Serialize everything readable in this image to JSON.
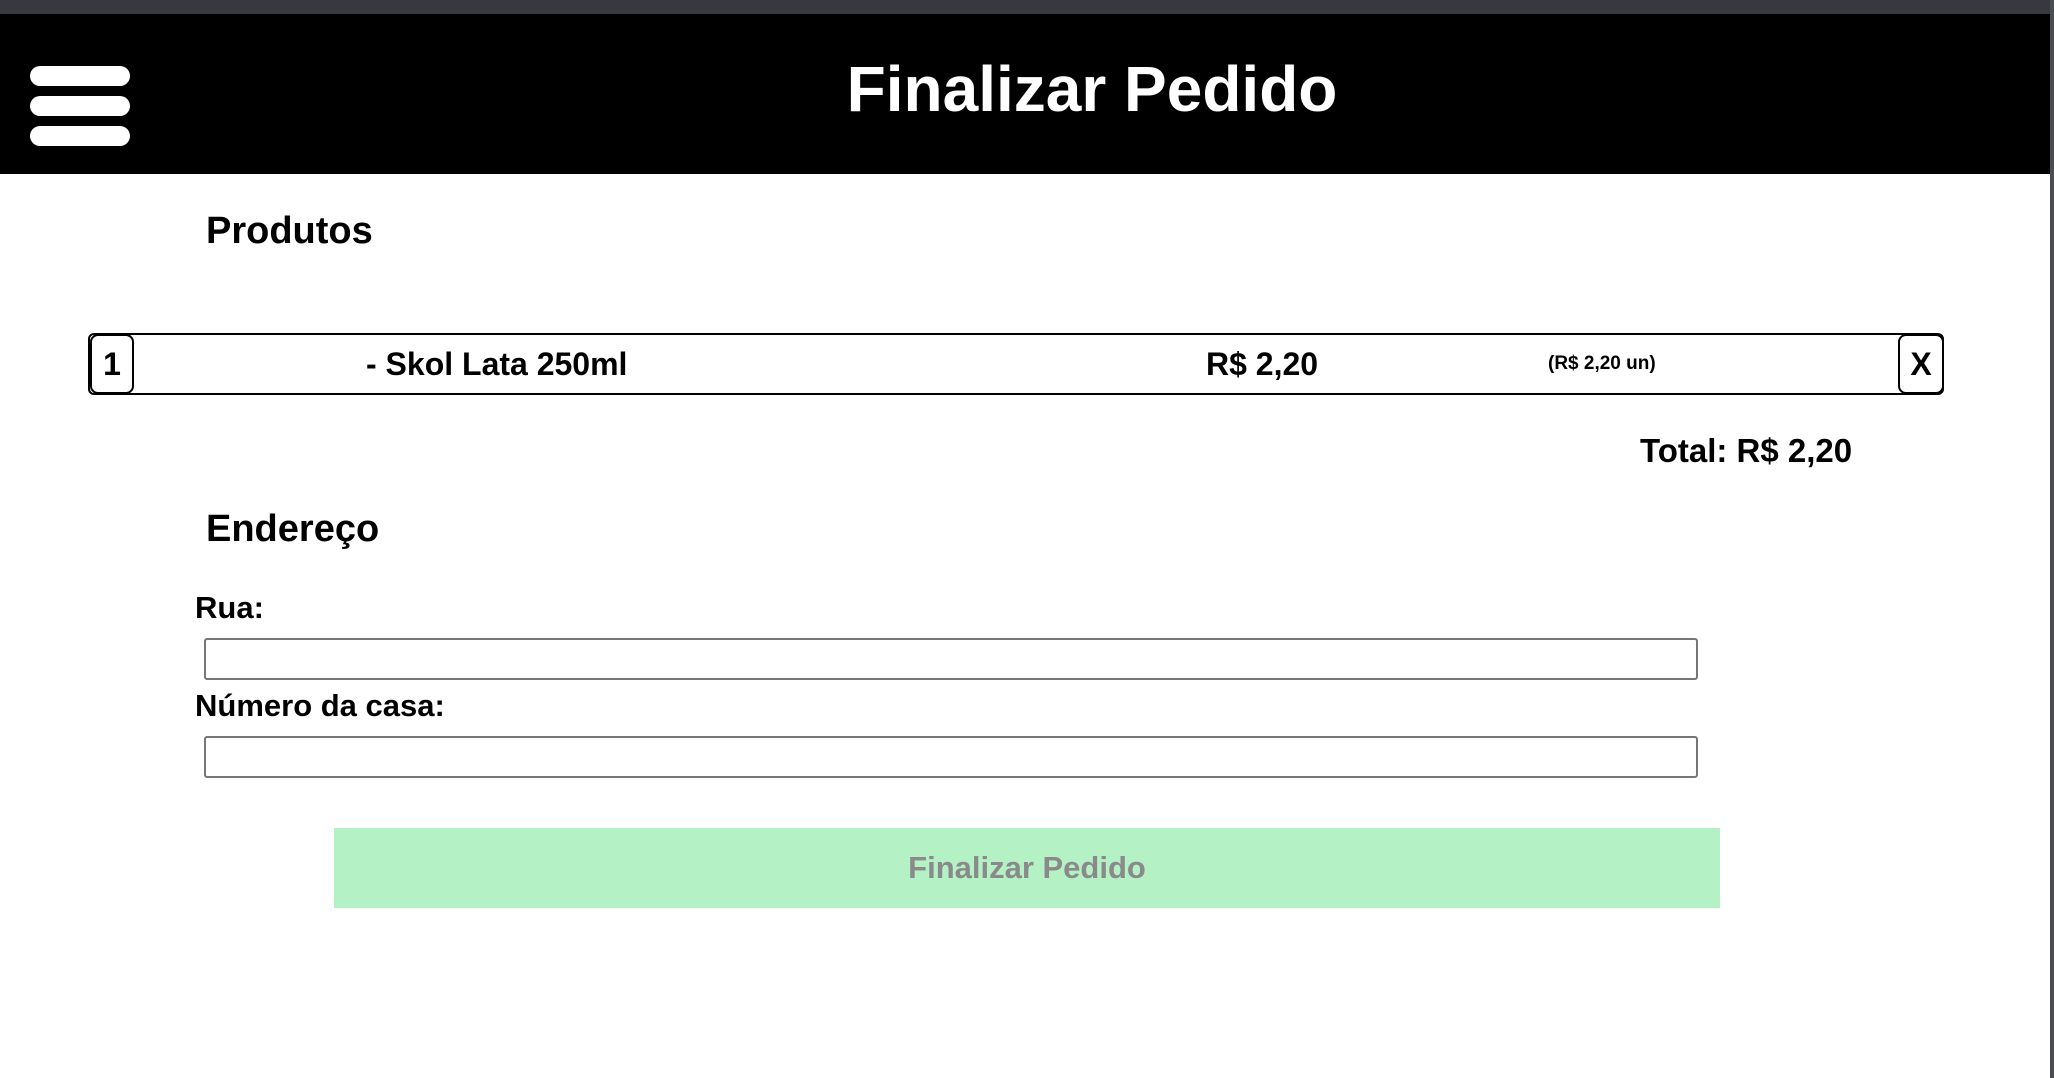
{
  "header": {
    "title": "Finalizar Pedido",
    "menu_icon": "hamburger-menu-icon"
  },
  "produtos": {
    "title": "Produtos",
    "items": [
      {
        "quantity": "1",
        "name": "- Skol Lata 250ml",
        "price": "R$ 2,20",
        "unit_price": "(R$ 2,20 un)",
        "remove_label": "X"
      }
    ],
    "total": "Total: R$ 2,20"
  },
  "endereco": {
    "title": "Endereço",
    "rua_label": "Rua:",
    "rua_value": "",
    "numero_label": "Número da casa:",
    "numero_value": ""
  },
  "submit": {
    "label": "Finalizar Pedido",
    "background": "#b4f1c5",
    "text_color": "#8a8a8a"
  }
}
